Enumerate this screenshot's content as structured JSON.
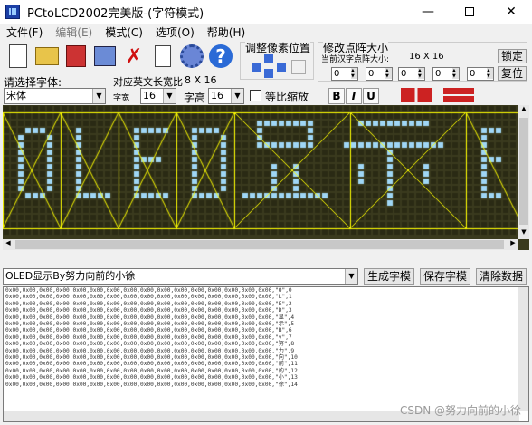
{
  "window": {
    "title": "PCtoLCD2002完美版-(字符模式)"
  },
  "menu": [
    {
      "label": "文件(F)",
      "enabled": true
    },
    {
      "label": "编辑(E)",
      "enabled": false
    },
    {
      "label": "模式(C)",
      "enabled": true
    },
    {
      "label": "选项(O)",
      "enabled": true
    },
    {
      "label": "帮助(H)",
      "enabled": true
    }
  ],
  "toolbar": {
    "pixel_group_label": "调整像素位置",
    "zoom_group_label": "修改点阵大小",
    "current_size_label": "当前汉字点阵大小:",
    "current_size_value": "16 X 16",
    "lock_button": "锁定",
    "reset_button": "复位",
    "spin_values": [
      "0",
      "0",
      "0",
      "0",
      "0"
    ],
    "font_label": "请选择字体:",
    "font_value": "宋体",
    "ascii_width_label": "对应英文长宽比",
    "ascii_width_value": "8 X 16",
    "char_width_label": "字宽",
    "char_width_value": "16",
    "char_height_label": "字高",
    "char_height_value": "16",
    "ratio_checkbox_label": "等比缩放",
    "bold_label": "B",
    "italic_label": "I",
    "underline_label": "U"
  },
  "lcd_colors": {
    "bg": "#3a3a1e",
    "pixel_on": "#9fd6f5",
    "pixel_off": "#2a2a14",
    "guide": "#ffff00"
  },
  "text_input_value": "OLED显示By努力向前的小徐",
  "actions": {
    "generate": "生成字模",
    "save": "保存字模",
    "clear": "清除数据"
  },
  "output_lines": [
    "0x00,0x00,0x00,0x00,0x00,0x00,0x00,0x00,0x00,0x00,0x00,0x00,0x00,0x00,0x00,0x00,\"O\",0",
    "0x00,0x00,0x00,0x00,0x00,0x00,0x00,0x00,0x00,0x00,0x00,0x00,0x00,0x00,0x00,0x00,\"L\",1",
    "0x00,0x00,0x00,0x00,0x00,0x00,0x00,0x00,0x00,0x00,0x00,0x00,0x00,0x00,0x00,0x00,\"E\",2",
    "0x00,0x00,0x00,0x00,0x00,0x00,0x00,0x00,0x00,0x00,0x00,0x00,0x00,0x00,0x00,0x00,\"D\",3",
    "0x00,0x00,0x00,0x00,0x00,0x00,0x00,0x00,0x00,0x00,0x00,0x00,0x00,0x00,0x00,0x00,\"显\",4",
    "0x00,0x00,0x00,0x00,0x00,0x00,0x00,0x00,0x00,0x00,0x00,0x00,0x00,0x00,0x00,0x00,\"示\",5",
    "0x00,0x00,0x00,0x00,0x00,0x00,0x00,0x00,0x00,0x00,0x00,0x00,0x00,0x00,0x00,0x00,\"B\",6",
    "0x00,0x00,0x00,0x00,0x00,0x00,0x00,0x00,0x00,0x00,0x00,0x00,0x00,0x00,0x00,0x00,\"y\",7",
    "0x00,0x00,0x00,0x00,0x00,0x00,0x00,0x00,0x00,0x00,0x00,0x00,0x00,0x00,0x00,0x00,\"努\",8",
    "0x00,0x00,0x00,0x00,0x00,0x00,0x00,0x00,0x00,0x00,0x00,0x00,0x00,0x00,0x00,0x00,\"力\",9",
    "0x00,0x00,0x00,0x00,0x00,0x00,0x00,0x00,0x00,0x00,0x00,0x00,0x00,0x00,0x00,0x00,\"向\",10",
    "0x00,0x00,0x00,0x00,0x00,0x00,0x00,0x00,0x00,0x00,0x00,0x00,0x00,0x00,0x00,0x00,\"前\",11",
    "0x00,0x00,0x00,0x00,0x00,0x00,0x00,0x00,0x00,0x00,0x00,0x00,0x00,0x00,0x00,0x00,\"的\",12",
    "0x00,0x00,0x00,0x00,0x00,0x00,0x00,0x00,0x00,0x00,0x00,0x00,0x00,0x00,0x00,0x00,\"小\",13",
    "0x00,0x00,0x00,0x00,0x00,0x00,0x00,0x00,0x00,0x00,0x00,0x00,0x00,0x00,0x00,0x00,\"徐\",14"
  ],
  "watermark": "CSDN @努力向前的小徐"
}
